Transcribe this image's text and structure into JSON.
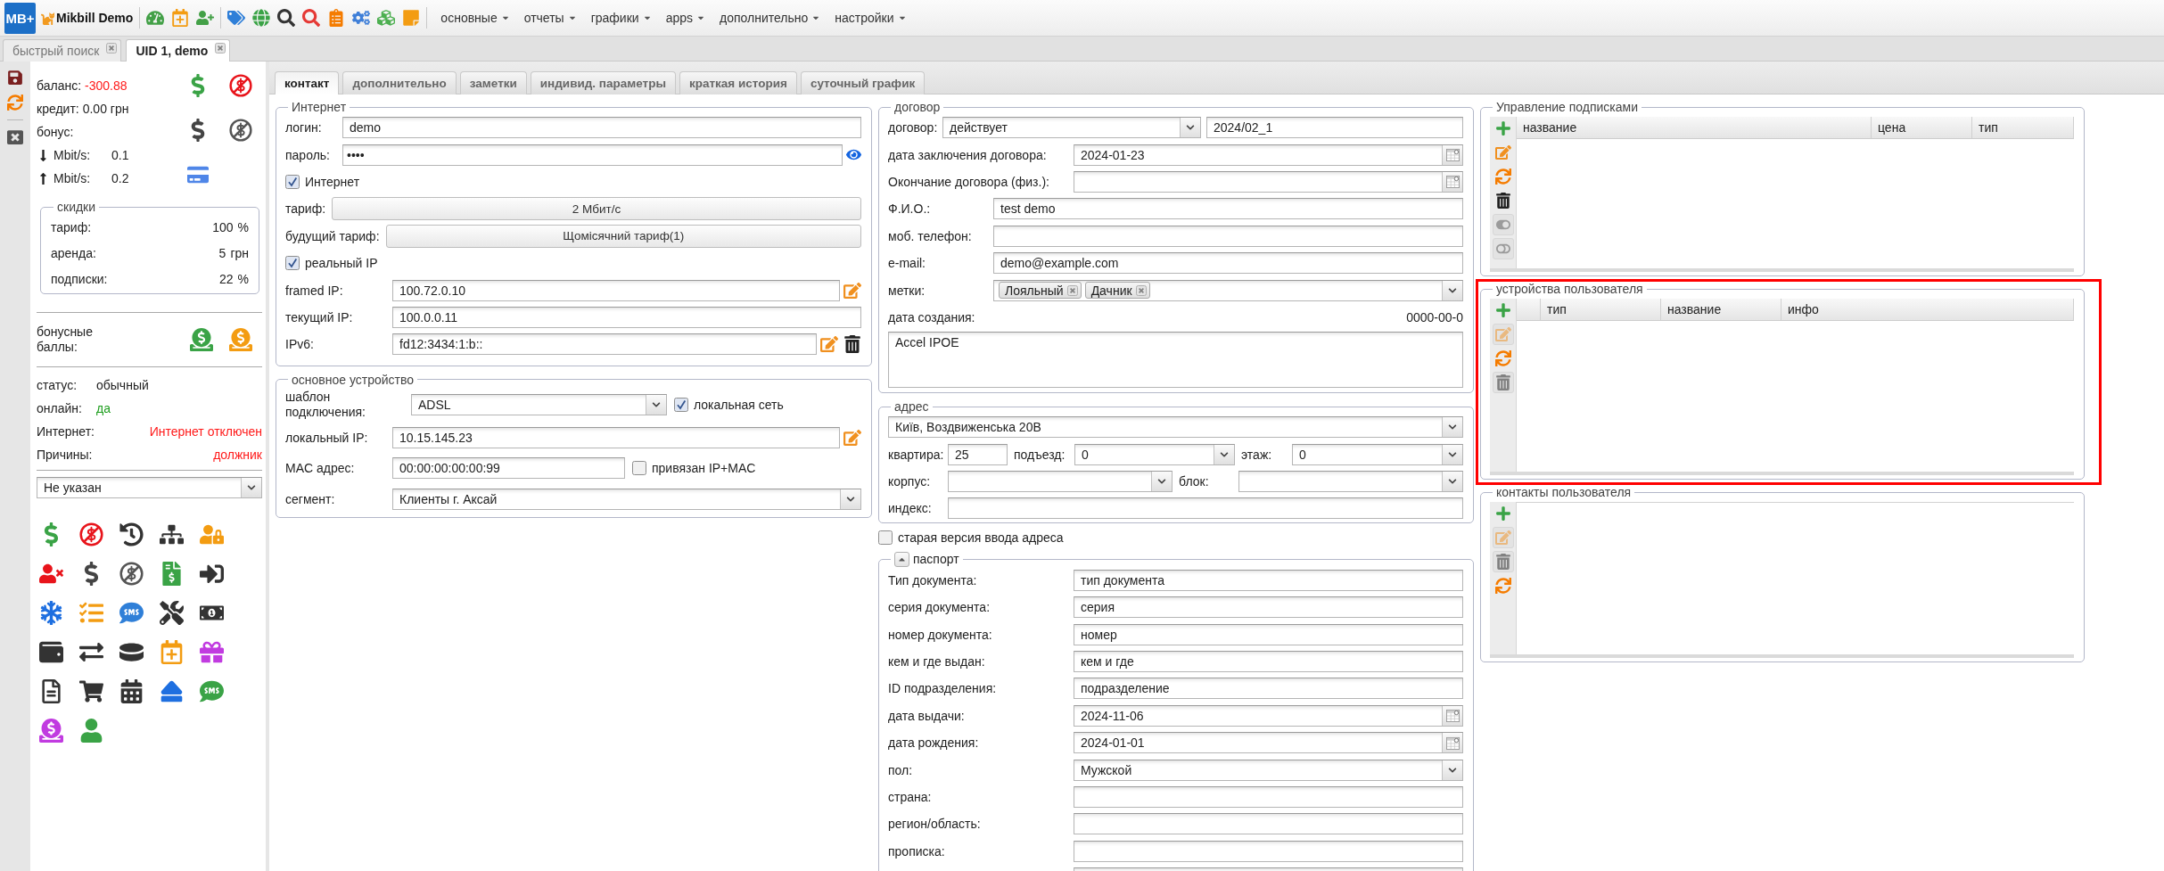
{
  "top_bar": {
    "logo": "MB+",
    "brand": "Mikbill Demo",
    "menus": [
      "основные",
      "отчеты",
      "графики",
      "apps",
      "дополнительно",
      "настройки"
    ]
  },
  "window_tabs": [
    {
      "label": "быстрый поиск",
      "selected": false
    },
    {
      "label": "UID 1, demo",
      "selected": true
    }
  ],
  "account": {
    "rows": [
      {
        "kind": "money",
        "label": "баланс:",
        "value": "-300.88",
        "color": "#ff1a1a"
      },
      {
        "kind": "money",
        "label": "кредит:",
        "value": "0.00 грн",
        "color": "#222222"
      },
      {
        "kind": "money",
        "label": "бонус:"
      },
      {
        "kind": "down",
        "label": "Mbit/s:",
        "value": "0.1",
        "color": "#222222"
      },
      {
        "kind": "up",
        "label": "Mbit/s:",
        "value": "0.2",
        "color": "#222222"
      }
    ],
    "discounts": {
      "title": "скидки",
      "rows": [
        {
          "label": "тариф:",
          "value": "100",
          "unit": "%"
        },
        {
          "label": "аренда:",
          "value": "5",
          "unit": "грн"
        },
        {
          "label": "подписки:",
          "value": "22",
          "unit": "%"
        }
      ]
    },
    "bonus_points": {
      "label": "бонусные баллы:"
    },
    "status": [
      {
        "kind": "inline",
        "label": "статус:",
        "value": "обычный",
        "color": "#222222"
      },
      {
        "kind": "inline",
        "label": "онлайн:",
        "value": "да",
        "color": "#1e9e1e"
      },
      {
        "kind": "flag",
        "label": "Интернет:",
        "value": "Интернет отключен",
        "color": "#ff1a1a"
      },
      {
        "kind": "flag",
        "label": "Причины:",
        "value": "должник",
        "color": "#ff1a1a"
      }
    ],
    "group_select": {
      "value": "Не указан"
    }
  },
  "content_tabs": [
    {
      "label": "контакт",
      "selected": true
    },
    {
      "label": "дополнительно",
      "selected": false
    },
    {
      "label": "заметки",
      "selected": false
    },
    {
      "label": "индивид. параметры",
      "selected": false
    },
    {
      "label": "краткая история",
      "selected": false
    },
    {
      "label": "суточный график",
      "selected": false
    }
  ],
  "internet": {
    "title": "Интернет",
    "rows": [
      {
        "kind": "text",
        "label": "логин:",
        "value": "demo"
      },
      {
        "kind": "password",
        "label": "пароль:",
        "value": "••••"
      },
      {
        "kind": "checkbox",
        "text": "Интернет",
        "checked": true
      },
      {
        "kind": "button",
        "label": "тариф:",
        "value": "2 Мбит/с"
      },
      {
        "kind": "button",
        "label": "будущий тариф:",
        "value": "Щомісячний тариф(1)"
      },
      {
        "kind": "checkbox",
        "text": "реальный IP",
        "checked": true
      },
      {
        "kind": "text",
        "label": "framed IP:",
        "value": "100.72.0.10",
        "actions": [
          {
            "kind": "edit"
          }
        ]
      },
      {
        "kind": "text",
        "label": "текущий IP:",
        "value": "100.0.0.11"
      },
      {
        "kind": "text",
        "label": "IPv6:",
        "value": "fd12:3434:1:b::",
        "actions": [
          {
            "kind": "edit"
          },
          {
            "kind": "delete"
          }
        ]
      }
    ]
  },
  "device": {
    "title": "основное устройство",
    "rows": [
      {
        "kind": "select",
        "label": "шаблон подключения:",
        "value": "ADSL",
        "option": {
          "label": "локальная сеть",
          "checked": true
        }
      },
      {
        "kind": "text",
        "label": "локальный IP:",
        "value": "10.15.145.23",
        "actions": [
          {
            "kind": "edit"
          }
        ]
      },
      {
        "kind": "text",
        "label": "MAC адрес:",
        "value": "00:00:00:00:00:99",
        "option": {
          "label": "привязан IP+MAC",
          "checked": false
        }
      },
      {
        "kind": "select",
        "label": "сегмент:",
        "value": "Клиенты г. Аксай"
      }
    ]
  },
  "contract": {
    "title": "договор",
    "rows": [
      {
        "kind": "contract",
        "label": "договор:",
        "value": "действует",
        "number": "2024/02_1"
      },
      {
        "kind": "date",
        "label": "дата заключения договора:",
        "value": "2024-01-23"
      },
      {
        "kind": "date",
        "label": "Окончание договора (физ.):"
      },
      {
        "kind": "text",
        "label": "Ф.И.О.:",
        "value": "test demo"
      },
      {
        "kind": "text",
        "label": "моб. телефон:"
      },
      {
        "kind": "text",
        "label": "e-mail:",
        "value": "demo@example.com"
      },
      {
        "kind": "tags",
        "label": "метки:",
        "tags": [
          "Лояльный",
          "Дачник"
        ]
      },
      {
        "kind": "info",
        "label": "дата создания:",
        "value": "0000-00-0"
      },
      {
        "kind": "textarea",
        "value": "Accel IPOE"
      }
    ]
  },
  "address": {
    "title": "адрес",
    "street": {
      "value": "Київ, Воздвиженська 20В"
    },
    "apartment": {
      "label": "квартира:",
      "value": "25"
    },
    "entrance": {
      "label": "подъезд:",
      "value": "0"
    },
    "floor": {
      "label": "этаж:",
      "value": "0"
    },
    "building": {
      "label": "корпус:"
    },
    "block": {
      "label": "блок:"
    },
    "postcode": {
      "label": "индекс:"
    }
  },
  "old_address_input": {
    "label": "старая версия ввода адреса",
    "checked": false
  },
  "passport": {
    "title": "паспорт",
    "expanded": true,
    "rows": [
      {
        "kind": "text",
        "label": "Тип документа:",
        "value": "тип документа"
      },
      {
        "kind": "text",
        "label": "серия документа:",
        "value": "серия"
      },
      {
        "kind": "text",
        "label": "номер документа:",
        "value": "номер"
      },
      {
        "kind": "text",
        "label": "кем и где выдан:",
        "value": "кем и где"
      },
      {
        "kind": "text",
        "label": "ID подразделения:",
        "value": "подразделение"
      },
      {
        "kind": "date",
        "label": "дата выдачи:",
        "value": "2024-11-06"
      },
      {
        "kind": "date",
        "label": "дата рождения:",
        "value": "2024-01-01"
      },
      {
        "kind": "select",
        "label": "пол:",
        "value": "Мужской"
      },
      {
        "kind": "text",
        "label": "страна:"
      },
      {
        "kind": "text",
        "label": "регион/область:"
      },
      {
        "kind": "text",
        "label": "прописка:"
      },
      {
        "kind": "text"
      }
    ]
  },
  "subscriptions": {
    "title": "Управление подписками",
    "highlighted": false,
    "tools": [
      {
        "kind": "add",
        "disabled": false
      },
      {
        "kind": "edit",
        "disabled": false
      },
      {
        "kind": "refresh",
        "disabled": false
      },
      {
        "kind": "delete",
        "disabled": false
      },
      {
        "kind": "toggle_on",
        "disabled": true
      },
      {
        "kind": "toggle_off",
        "disabled": true
      }
    ],
    "columns": [
      {
        "kind": "text",
        "label": "название"
      },
      {
        "kind": "text",
        "label": "цена"
      },
      {
        "kind": "text",
        "label": "тип"
      }
    ]
  },
  "devices": {
    "title": "устройства пользователя",
    "highlighted": true,
    "tools": [
      {
        "kind": "add",
        "disabled": false
      },
      {
        "kind": "edit",
        "disabled": true
      },
      {
        "kind": "refresh",
        "disabled": false
      },
      {
        "kind": "delete",
        "disabled": true
      }
    ],
    "columns": [
      {
        "kind": "blank"
      },
      {
        "kind": "text",
        "label": "тип"
      },
      {
        "kind": "text",
        "label": "название"
      },
      {
        "kind": "text",
        "label": "инфо"
      }
    ]
  },
  "contacts": {
    "title": "контакты пользователя",
    "highlighted": false,
    "tools": [
      {
        "kind": "add",
        "disabled": false
      },
      {
        "kind": "edit",
        "disabled": true
      },
      {
        "kind": "delete",
        "disabled": true
      },
      {
        "kind": "refresh",
        "disabled": false
      }
    ]
  }
}
